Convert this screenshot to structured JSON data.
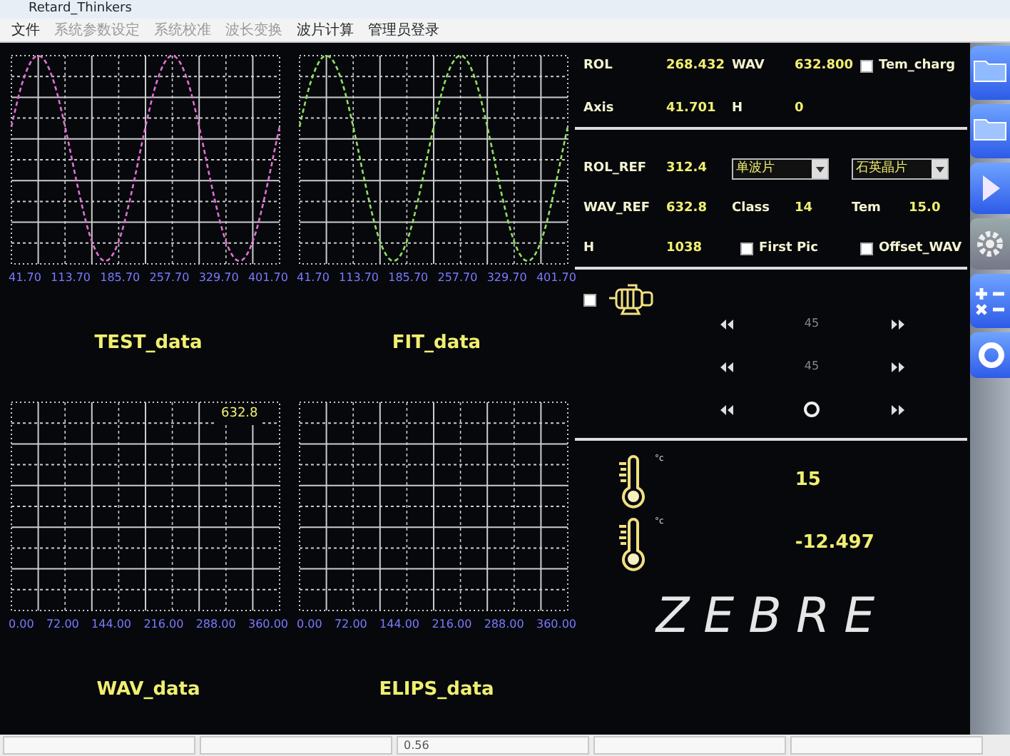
{
  "window": {
    "title": "Retard_Thinkers"
  },
  "menu": [
    {
      "label": "文件",
      "disabled": false
    },
    {
      "label": "系统参数设定",
      "disabled": true
    },
    {
      "label": "系统校准",
      "disabled": true
    },
    {
      "label": "波长变换",
      "disabled": true
    },
    {
      "label": "波片计算",
      "disabled": false
    },
    {
      "label": "管理员登录",
      "disabled": false
    }
  ],
  "plots": [
    {
      "title": "TEST_data",
      "kind": "wave",
      "color": "#e070d0",
      "x_ticks": [
        "41.70",
        "113.70",
        "185.70",
        "257.70",
        "329.70",
        "401.70"
      ]
    },
    {
      "title": "FIT_data",
      "kind": "wave",
      "color": "#90e060",
      "x_ticks": [
        "41.70",
        "113.70",
        "185.70",
        "257.70",
        "329.70",
        "401.70"
      ]
    },
    {
      "title": "WAV_data",
      "kind": "empty",
      "marker": "632.8",
      "x_ticks": [
        "0.00",
        "72.00",
        "144.00",
        "216.00",
        "288.00",
        "360.00"
      ]
    },
    {
      "title": "ELIPS_data",
      "kind": "empty",
      "x_ticks": [
        "0.00",
        "72.00",
        "144.00",
        "216.00",
        "288.00",
        "360.00"
      ]
    }
  ],
  "measurement": {
    "rows": [
      [
        {
          "kind": "label",
          "text": "ROL"
        },
        {
          "kind": "value",
          "text": "268.432"
        },
        {
          "kind": "label",
          "text": "WAV"
        },
        {
          "kind": "value",
          "text": "632.800"
        },
        {
          "kind": "check",
          "label": "Tem_charg",
          "checked": false
        }
      ],
      [
        {
          "kind": "label",
          "text": "Axis"
        },
        {
          "kind": "value",
          "text": "41.701"
        },
        {
          "kind": "label",
          "text": "H"
        },
        {
          "kind": "value",
          "text": "0"
        }
      ]
    ]
  },
  "reference": {
    "rows": [
      [
        {
          "kind": "label",
          "text": "ROL_REF"
        },
        {
          "kind": "value",
          "text": "312.4"
        },
        {
          "kind": "select",
          "value": "单波片"
        },
        {
          "kind": "select",
          "value": "石英晶片"
        }
      ],
      [
        {
          "kind": "label",
          "text": "WAV_REF"
        },
        {
          "kind": "value",
          "text": "632.8"
        },
        {
          "kind": "label",
          "text": "Class"
        },
        {
          "kind": "value",
          "text": "14"
        },
        {
          "kind": "label",
          "text": "Tem"
        },
        {
          "kind": "value",
          "text": "15.0"
        }
      ],
      [
        {
          "kind": "label",
          "text": "H"
        },
        {
          "kind": "value",
          "text": "1038"
        },
        {
          "kind": "check",
          "label": "First Pic",
          "checked": false
        },
        {
          "kind": "check",
          "label": "Offset_WAV",
          "checked": false
        }
      ]
    ]
  },
  "motor": {
    "checked": false,
    "steppers": [
      {
        "kind": "number",
        "text": "45"
      },
      {
        "kind": "number",
        "text": "45"
      },
      {
        "kind": "indicator"
      }
    ]
  },
  "temperatures": [
    {
      "unit": "°c",
      "value": "15"
    },
    {
      "unit": "°c",
      "value": "-12.497"
    }
  ],
  "brand": "ZEBRE",
  "status_bar": {
    "reading": "0.56"
  }
}
